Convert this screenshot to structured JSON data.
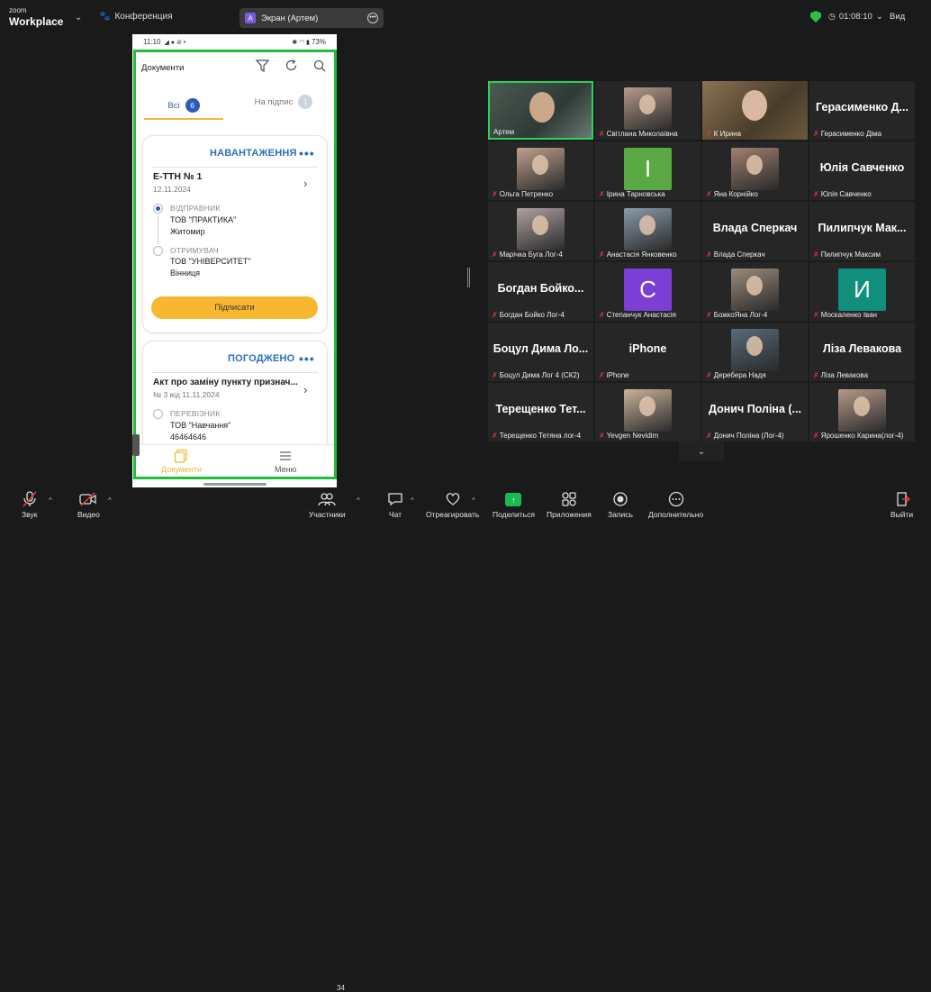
{
  "app": {
    "logo_top": "zoom",
    "logo_bottom": "Workplace",
    "conference_label": "Конференция",
    "screen_share_label": "Экран (Артем)",
    "screen_share_letter": "A",
    "timer": "01:08:10",
    "view_label": "Вид"
  },
  "phone": {
    "status_time": "11:10",
    "status_right": "73%",
    "header_title": "Документи",
    "tabs": [
      {
        "label": "Всі",
        "count": "6"
      },
      {
        "label": "На підпис",
        "count": "1"
      }
    ],
    "card1": {
      "status": "НАВАНТАЖЕННЯ",
      "dots": "•••",
      "doc_name": "Е-ТТН № 1",
      "doc_date": "12.11.2024",
      "sender_role": "ВІДПРАВНИК",
      "sender_org": "ТОВ \"ПРАКТИКА\"",
      "sender_city": "Житомир",
      "receiver_role": "ОТРИМУВАЧ",
      "receiver_org": "ТОВ \"УНІВЕРСИТЕТ\"",
      "receiver_city": "Вінниця",
      "sign_button": "Підписати"
    },
    "card2": {
      "status": "ПОГОДЖЕНО",
      "dots": "•••",
      "doc_name": "Акт про заміну пункту признач...",
      "doc_sub": "№ 3 від 11.11.2024",
      "carrier_role": "ПЕРЕВІЗНИК",
      "carrier_org": "ТОВ \"Навчання\"",
      "carrier_code": "46464646"
    },
    "nav": [
      {
        "label": "Документи",
        "color": "#f2b938"
      },
      {
        "label": "Меню",
        "color": "#555555"
      }
    ]
  },
  "participants": [
    {
      "name": "Артем",
      "muted": false,
      "type": "video",
      "active": true
    },
    {
      "name": "Світлана Миколаївна",
      "muted": true,
      "type": "photo"
    },
    {
      "name": "К Ирина",
      "muted": true,
      "type": "video"
    },
    {
      "name": "Герасименко Діма",
      "muted": true,
      "type": "text",
      "big": "Герасименко Д..."
    },
    {
      "name": "Ольга Петренко",
      "muted": true,
      "type": "photo"
    },
    {
      "name": "Ірина Тарновська",
      "muted": true,
      "type": "letter",
      "letter": "I",
      "color": "#5aa843"
    },
    {
      "name": "Яна Корнійко",
      "muted": true,
      "type": "photo"
    },
    {
      "name": "Юлія Савченко",
      "muted": true,
      "type": "text",
      "big": "Юлія Савченко"
    },
    {
      "name": "Марічка Буга Лог-4",
      "muted": true,
      "type": "photo"
    },
    {
      "name": "Анастасія Янковенко",
      "muted": true,
      "type": "photo"
    },
    {
      "name": "Влада Сперкач",
      "muted": true,
      "type": "text",
      "big": "Влада Сперкач"
    },
    {
      "name": "Пилипчук Максим",
      "muted": true,
      "type": "text",
      "big": "Пилипчук Мак..."
    },
    {
      "name": "Богдан Бойко Лог-4",
      "muted": true,
      "type": "text",
      "big": "Богдан Бойко..."
    },
    {
      "name": "Степанчук Анастасія",
      "muted": true,
      "type": "letter",
      "letter": "C",
      "color": "#7b3fd6"
    },
    {
      "name": "БожкоЯна Лог-4",
      "muted": true,
      "type": "photo"
    },
    {
      "name": "Москаленко Іван",
      "muted": true,
      "type": "letter",
      "letter": "И",
      "color": "#0f8f7c"
    },
    {
      "name": "Боцул Дима Лог 4 (СК2)",
      "muted": true,
      "type": "text",
      "big": "Боцул Дима Ло..."
    },
    {
      "name": "iPhone",
      "muted": true,
      "type": "text",
      "big": "iPhone"
    },
    {
      "name": "Деребера Надя",
      "muted": true,
      "type": "photo"
    },
    {
      "name": "Ліза Левакова",
      "muted": true,
      "type": "text",
      "big": "Ліза Левакова"
    },
    {
      "name": "Терещенко Тетяна лог-4",
      "muted": true,
      "type": "text",
      "big": "Терещенко Тет..."
    },
    {
      "name": "Yevgen Nevidim",
      "muted": true,
      "type": "photo"
    },
    {
      "name": "Донич Поліна (Лог-4)",
      "muted": true,
      "type": "text",
      "big": "Донич Поліна (..."
    },
    {
      "name": "Ярошенко Карина(лог-4)",
      "muted": true,
      "type": "photo"
    }
  ],
  "toolbar": {
    "items": [
      {
        "label": "Звук",
        "icon": "🎤"
      },
      {
        "label": "Видео",
        "icon": "🎥"
      },
      {
        "label": "Участники",
        "icon": "👥",
        "count": "34"
      },
      {
        "label": "Чат",
        "icon": "💬"
      },
      {
        "label": "Отреагировать",
        "icon": "♡"
      },
      {
        "label": "Поделиться",
        "icon": "↑"
      },
      {
        "label": "Приложения",
        "icon": "⧉"
      },
      {
        "label": "Запись",
        "icon": "◉"
      },
      {
        "label": "Дополнительно",
        "icon": "⋯"
      },
      {
        "label": "Выйти",
        "icon": "🚪"
      }
    ]
  }
}
